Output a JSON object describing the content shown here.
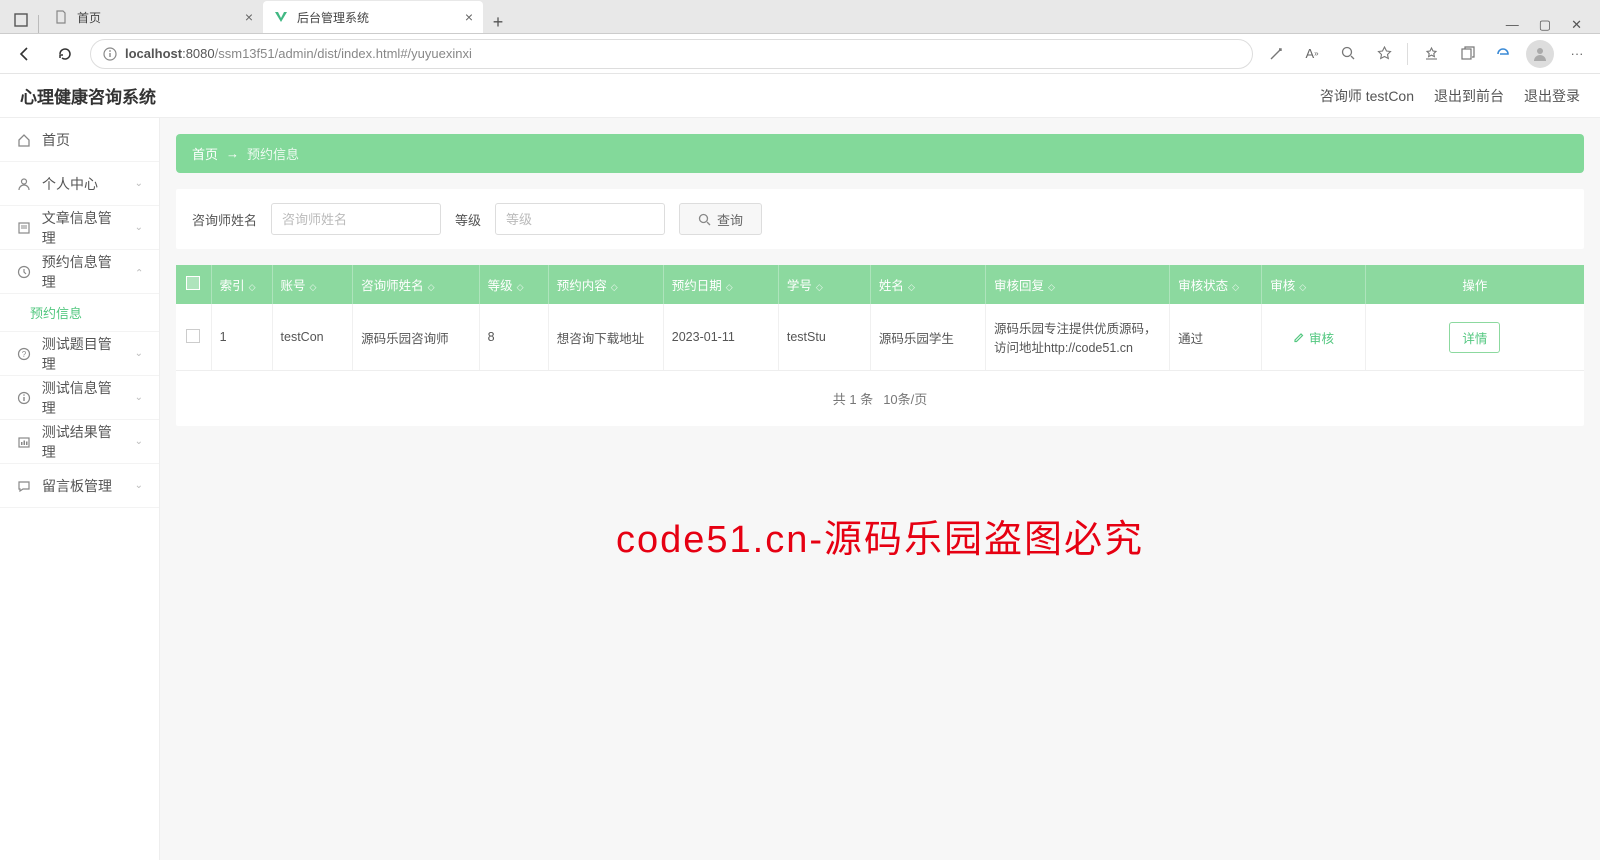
{
  "browser": {
    "tabs": [
      {
        "title": "首页",
        "active": false
      },
      {
        "title": "后台管理系统",
        "active": true
      }
    ],
    "url_host": "localhost",
    "url_port": ":8080",
    "url_path": "/ssm13f51/admin/dist/index.html#/yuyuexinxi"
  },
  "app": {
    "title": "心理健康咨询系统",
    "user_label": "咨询师 testCon",
    "to_front": "退出到前台",
    "logout": "退出登录"
  },
  "sidebar": {
    "items": [
      {
        "icon": "home",
        "label": "首页"
      },
      {
        "icon": "user",
        "label": "个人中心",
        "expandable": true
      },
      {
        "icon": "doc",
        "label": "文章信息管理",
        "expandable": true
      },
      {
        "icon": "cal",
        "label": "预约信息管理",
        "expandable": true,
        "open": true,
        "children": [
          {
            "label": "预约信息",
            "active": true
          }
        ]
      },
      {
        "icon": "q",
        "label": "测试题目管理",
        "expandable": true
      },
      {
        "icon": "info",
        "label": "测试信息管理",
        "expandable": true
      },
      {
        "icon": "res",
        "label": "测试结果管理",
        "expandable": true
      },
      {
        "icon": "msg",
        "label": "留言板管理",
        "expandable": true
      }
    ]
  },
  "breadcrumb": {
    "root": "首页",
    "sep": "→",
    "current": "预约信息"
  },
  "filters": {
    "name_label": "咨询师姓名",
    "name_ph": "咨询师姓名",
    "level_label": "等级",
    "level_ph": "等级",
    "query_btn": "查询"
  },
  "table": {
    "headers": [
      "索引",
      "账号",
      "咨询师姓名",
      "等级",
      "预约内容",
      "预约日期",
      "学号",
      "姓名",
      "审核回复",
      "审核状态",
      "审核",
      "操作"
    ],
    "rows": [
      {
        "index": "1",
        "account": "testCon",
        "counselor": "源码乐园咨询师",
        "level": "8",
        "content": "想咨询下载地址",
        "date": "2023-01-11",
        "student_no": "testStu",
        "student_name": "源码乐园学生",
        "reply": "源码乐园专注提供优质源码，访问地址http://code51.cn",
        "status": "通过",
        "audit_action": "审核",
        "detail": "详情"
      }
    ]
  },
  "pagination": {
    "total_label": "共 1 条",
    "page_size": "10条/页"
  },
  "watermark": "code51.cn-源码乐园盗图必究"
}
